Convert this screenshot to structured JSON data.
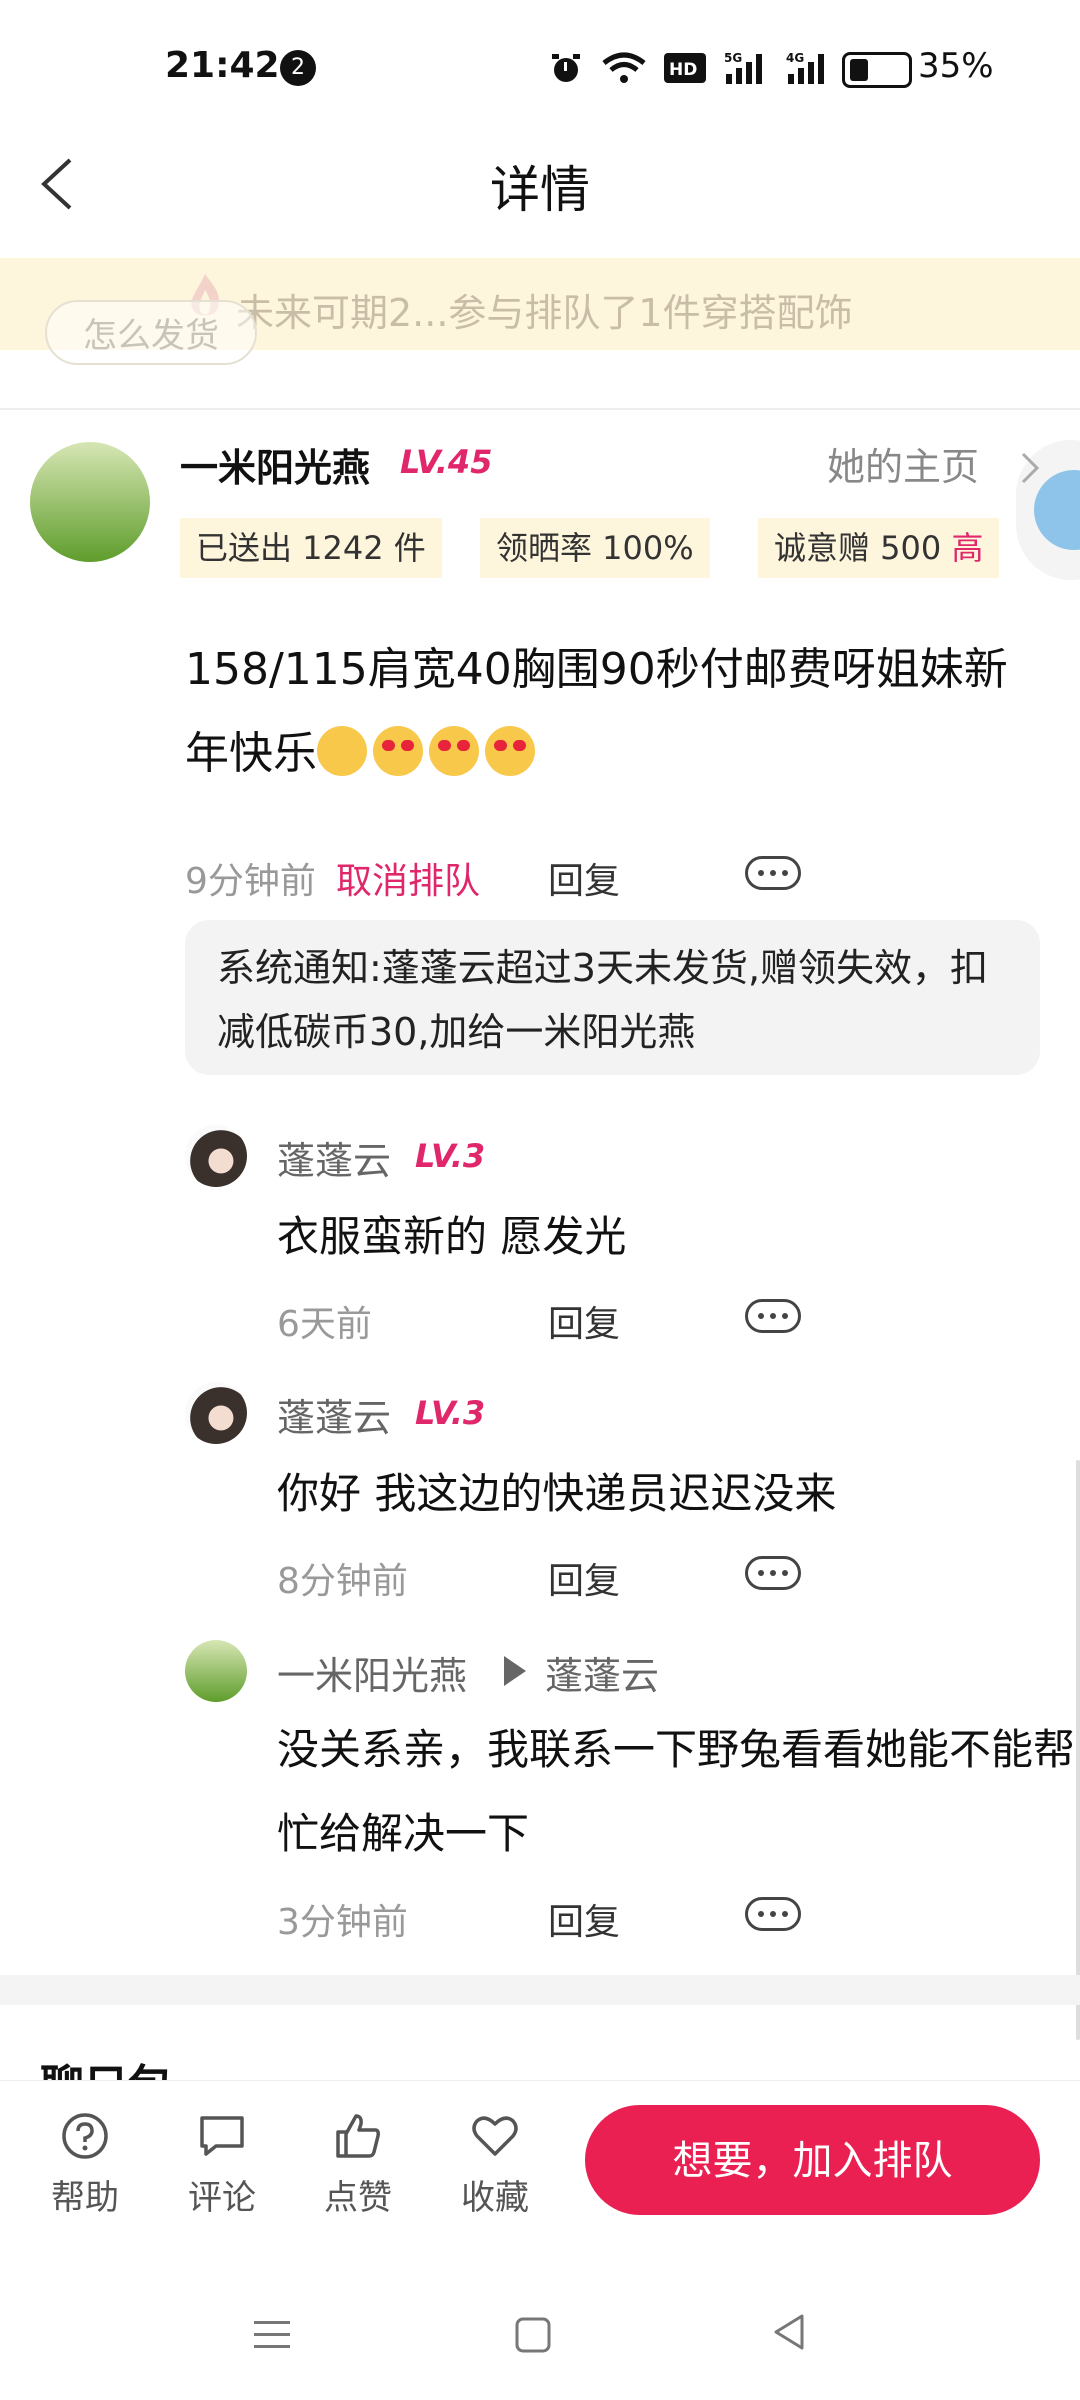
{
  "status_bar": {
    "time": "21:42",
    "notif_count": "2",
    "battery_level": 0.35,
    "battery": "35%"
  },
  "header": {
    "title": "详情"
  },
  "banner": {
    "text": "未来可期2...参与排队了1件穿搭配饰",
    "tag": "怎么发货"
  },
  "user": {
    "name": "一米阳光燕",
    "level": "LV.45",
    "home_link": "她的主页",
    "stats": {
      "sent": "已送出 1242 件",
      "rate": "领晒率 100%",
      "gift": "诚意赠 500",
      "gift_tag": "高"
    }
  },
  "post": {
    "text": "158/115肩宽40胸围90秒付邮费呀姐妹新年快乐",
    "time": "9分钟前",
    "cancel_label": "取消排队",
    "reply_label": "回复"
  },
  "system_notice": "系统通知:蓬蓬云超过3天未发货,赠领失效，扣减低碳币30,加给一米阳光燕",
  "comments": [
    {
      "name": "蓬蓬云",
      "level": "LV.3",
      "text": "衣服蛮新的 愿发光",
      "time": "6天前",
      "reply_label": "回复"
    },
    {
      "name": "蓬蓬云",
      "level": "LV.3",
      "text": "你好 我这边的快递员迟迟没来",
      "time": "8分钟前",
      "reply_label": "回复"
    },
    {
      "name": "一米阳光燕",
      "reply_to": "蓬蓬云",
      "text": "没关系亲，我联系一下野兔看看她能不能帮忙给解决一下",
      "time": "3分钟前",
      "reply_label": "回复"
    }
  ],
  "section_peek": "聊只包",
  "bottom_bar": {
    "help": "帮助",
    "comment": "评论",
    "like": "点赞",
    "favorite": "收藏",
    "primary_button": "想要，加入排队"
  },
  "colors": {
    "accent": "#ea1f52",
    "level": "#e0276b",
    "banner_bg": "#fdf6dd"
  }
}
